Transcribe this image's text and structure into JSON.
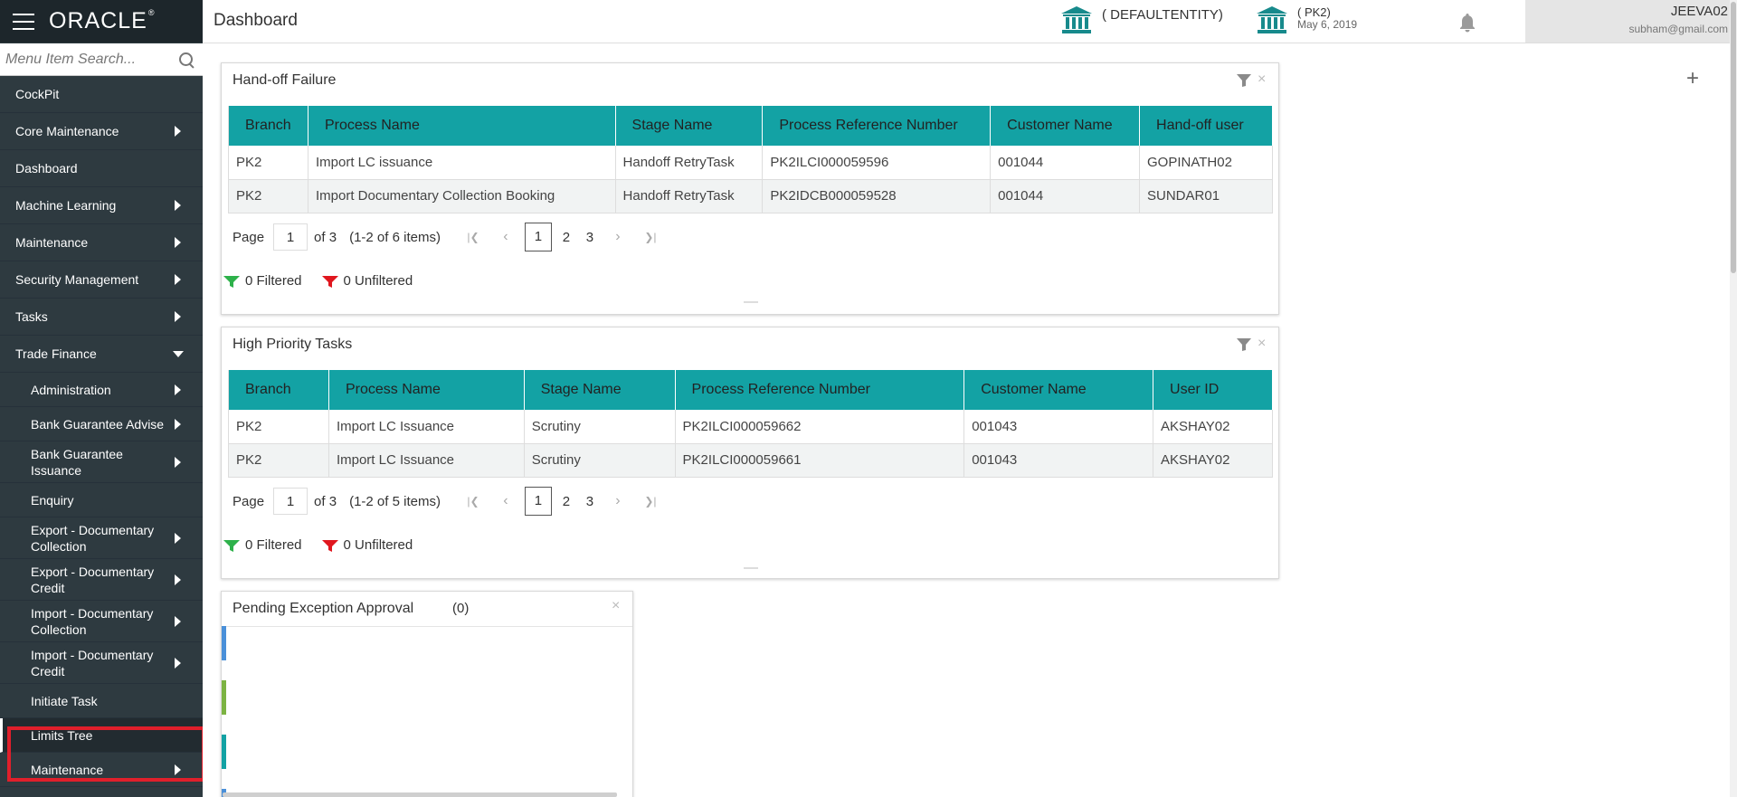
{
  "app": {
    "brand": "ORACLE",
    "page_title": "Dashboard"
  },
  "sidebar": {
    "search_placeholder": "Menu Item Search...",
    "items": [
      {
        "label": "CockPit",
        "level": 1,
        "arrow": "none"
      },
      {
        "label": "Core Maintenance",
        "level": 1,
        "arrow": "right"
      },
      {
        "label": "Dashboard",
        "level": 1,
        "arrow": "none"
      },
      {
        "label": "Machine Learning",
        "level": 1,
        "arrow": "right"
      },
      {
        "label": "Maintenance",
        "level": 1,
        "arrow": "right"
      },
      {
        "label": "Security Management",
        "level": 1,
        "arrow": "right"
      },
      {
        "label": "Tasks",
        "level": 1,
        "arrow": "right"
      },
      {
        "label": "Trade Finance",
        "level": 1,
        "arrow": "down"
      },
      {
        "label": "Administration",
        "level": 2,
        "arrow": "right"
      },
      {
        "label": "Bank Guarantee Advise",
        "level": 2,
        "arrow": "right"
      },
      {
        "label": "Bank Guarantee Issuance",
        "level": 2,
        "arrow": "right"
      },
      {
        "label": "Enquiry",
        "level": 2,
        "arrow": "none"
      },
      {
        "label": "Export - Documentary Collection",
        "level": 2,
        "arrow": "right"
      },
      {
        "label": "Export - Documentary Credit",
        "level": 2,
        "arrow": "right"
      },
      {
        "label": "Import - Documentary Collection",
        "level": 2,
        "arrow": "right"
      },
      {
        "label": "Import - Documentary Credit",
        "level": 2,
        "arrow": "right"
      },
      {
        "label": "Initiate Task",
        "level": 2,
        "arrow": "none"
      },
      {
        "label": "Limits Tree",
        "level": 2,
        "arrow": "none",
        "highlighted": true
      },
      {
        "label": "Maintenance",
        "level": 2,
        "arrow": "right"
      }
    ]
  },
  "header": {
    "entity_label": "( DEFAULTENTITY)",
    "branch_label": "( PK2)",
    "branch_date": "May 6, 2019",
    "user_name": "JEEVA02",
    "user_email": "subham@gmail.com"
  },
  "handoff": {
    "title": "Hand-off Failure",
    "close": "×",
    "columns": [
      "Branch",
      "Process Name",
      "Stage Name",
      "Process Reference Number",
      "Customer Name",
      "Hand-off user"
    ],
    "rows": [
      [
        "PK2",
        "Import LC issuance",
        "Handoff RetryTask",
        "PK2ILCI000059596",
        "001044",
        "GOPINATH02"
      ],
      [
        "PK2",
        "Import Documentary Collection Booking",
        "Handoff RetryTask",
        "PK2IDCB000059528",
        "001044",
        "SUNDAR01"
      ]
    ],
    "pager": {
      "label": "Page",
      "value": "1",
      "of": "of 3",
      "items": "(1-2 of 6 items)",
      "pages": [
        "1",
        "2",
        "3"
      ]
    },
    "filtered": "0 Filtered",
    "unfiltered": "0 Unfiltered"
  },
  "priority": {
    "title": "High Priority Tasks",
    "close": "×",
    "columns": [
      "Branch",
      "Process Name",
      "Stage Name",
      "Process Reference Number",
      "Customer Name",
      "User ID"
    ],
    "rows": [
      [
        "PK2",
        "Import LC Issuance",
        "Scrutiny",
        "PK2ILCI000059662",
        "001043",
        "AKSHAY02"
      ],
      [
        "PK2",
        "Import LC Issuance",
        "Scrutiny",
        "PK2ILCI000059661",
        "001043",
        "AKSHAY02"
      ]
    ],
    "pager": {
      "label": "Page",
      "value": "1",
      "of": "of 3",
      "items": "(1-2 of 5 items)",
      "pages": [
        "1",
        "2",
        "3"
      ]
    },
    "filtered": "0 Filtered",
    "unfiltered": "0 Unfiltered"
  },
  "pending": {
    "title": "Pending Exception Approval",
    "count": "(0)",
    "close": "×",
    "bar_colors": [
      "#4a90d9",
      "#7cb342",
      "#13a2a4",
      "#4a90d9"
    ]
  },
  "colors": {
    "sidebar_bg": "#2e3a40",
    "table_header": "#13a2a4",
    "highlight_border": "#e01f2b",
    "filtered_funnel": "#2db14a",
    "unfiltered_funnel": "#e0161e"
  },
  "icons": {
    "menu": "hamburger-icon",
    "search": "search-icon",
    "entity": "bank-icon",
    "notifications": "bell-icon",
    "add_widget": "plus-icon",
    "filter": "filter-icon"
  }
}
